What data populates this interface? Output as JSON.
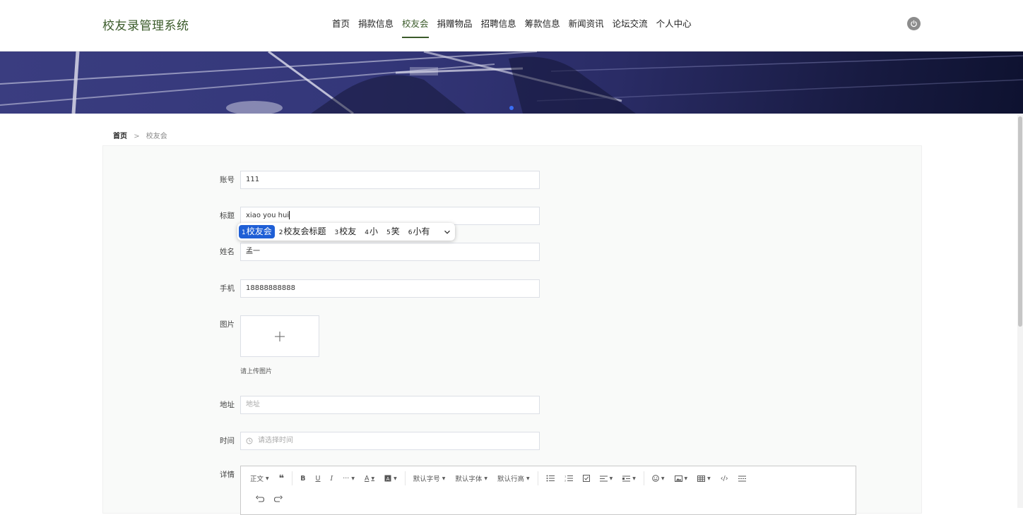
{
  "header": {
    "brand": "校友录管理系统",
    "nav": [
      "首页",
      "捐款信息",
      "校友会",
      "捐赠物品",
      "招聘信息",
      "筹款信息",
      "新闻资讯",
      "论坛交流",
      "个人中心"
    ],
    "active_nav": "校友会",
    "power_icon": "power-icon"
  },
  "breadcrumb": {
    "home": "首页",
    "separator": ">",
    "current": "校友会"
  },
  "form": {
    "account": {
      "label": "账号",
      "value": "111"
    },
    "title": {
      "label": "标题",
      "value": "xiao you hui"
    },
    "name": {
      "label": "姓名",
      "value": "孟一"
    },
    "phone": {
      "label": "手机",
      "value": "18888888888"
    },
    "image": {
      "label": "图片",
      "hint": "请上传图片",
      "icon": "plus-icon"
    },
    "address": {
      "label": "地址",
      "placeholder": "地址"
    },
    "time": {
      "label": "时间",
      "placeholder": "请选择时间",
      "icon": "clock-icon"
    },
    "details": {
      "label": "详情"
    }
  },
  "ime": {
    "candidates": [
      {
        "num": "1",
        "text": "校友会"
      },
      {
        "num": "2",
        "text": "校友会标题"
      },
      {
        "num": "3",
        "text": "校友"
      },
      {
        "num": "4",
        "text": "小"
      },
      {
        "num": "5",
        "text": "笑"
      },
      {
        "num": "6",
        "text": "小有"
      }
    ],
    "selected_index": 0
  },
  "editor_toolbar": {
    "paragraph": "正文",
    "font_size": "默认字号",
    "font_family": "默认字体",
    "line_height": "默认行高"
  },
  "colors": {
    "accent": "#3b5b2a",
    "ime_highlight": "#1f5fd6",
    "banner": "#2a2c66"
  }
}
